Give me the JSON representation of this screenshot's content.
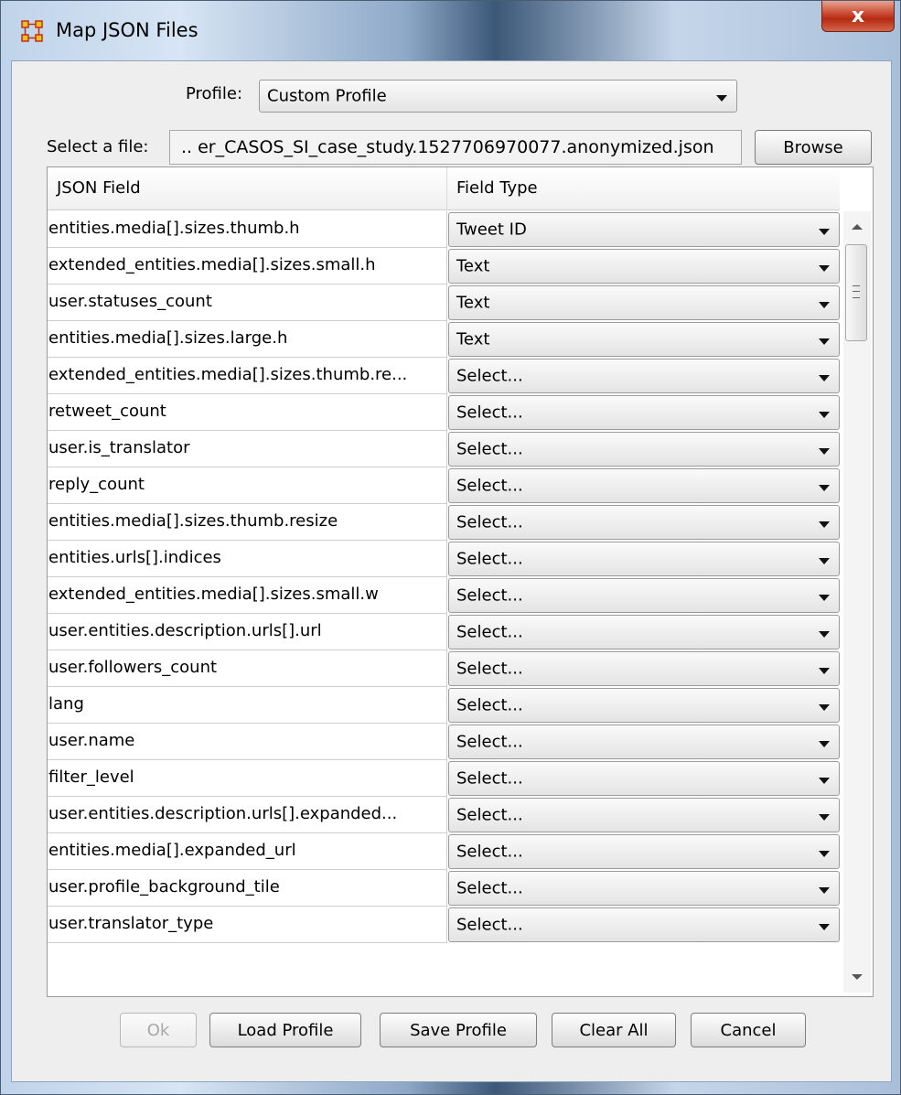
{
  "window": {
    "title": "Map JSON Files",
    "close_glyph": "x",
    "app_icon": "grid-network-icon",
    "accent_color": "#c7432b"
  },
  "profile": {
    "label": "Profile:",
    "value": "Custom Profile"
  },
  "file": {
    "label": "Select a file:",
    "value": ".. er_CASOS_SI_case_study.1527706970077.anonymized.json",
    "browse_label": "Browse"
  },
  "table": {
    "headers": [
      "JSON Field",
      "Field Type"
    ],
    "rows": [
      {
        "field": "entities.media[].sizes.thumb.h",
        "type": "Tweet ID"
      },
      {
        "field": "extended_entities.media[].sizes.small.h",
        "type": "Text"
      },
      {
        "field": "user.statuses_count",
        "type": "Text"
      },
      {
        "field": "entities.media[].sizes.large.h",
        "type": "Text"
      },
      {
        "field": "extended_entities.media[].sizes.thumb.re...",
        "type": "Select..."
      },
      {
        "field": "retweet_count",
        "type": "Select..."
      },
      {
        "field": "user.is_translator",
        "type": "Select..."
      },
      {
        "field": "reply_count",
        "type": "Select..."
      },
      {
        "field": "entities.media[].sizes.thumb.resize",
        "type": "Select..."
      },
      {
        "field": "entities.urls[].indices",
        "type": "Select..."
      },
      {
        "field": "extended_entities.media[].sizes.small.w",
        "type": "Select..."
      },
      {
        "field": "user.entities.description.urls[].url",
        "type": "Select..."
      },
      {
        "field": "user.followers_count",
        "type": "Select..."
      },
      {
        "field": "lang",
        "type": "Select..."
      },
      {
        "field": "user.name",
        "type": "Select..."
      },
      {
        "field": "filter_level",
        "type": "Select..."
      },
      {
        "field": "user.entities.description.urls[].expanded...",
        "type": "Select..."
      },
      {
        "field": "entities.media[].expanded_url",
        "type": "Select..."
      },
      {
        "field": "user.profile_background_tile",
        "type": "Select..."
      },
      {
        "field": "user.translator_type",
        "type": "Select..."
      }
    ]
  },
  "buttons": {
    "ok": "Ok",
    "load_profile": "Load Profile",
    "save_profile": "Save Profile",
    "clear_all": "Clear All",
    "cancel": "Cancel"
  }
}
